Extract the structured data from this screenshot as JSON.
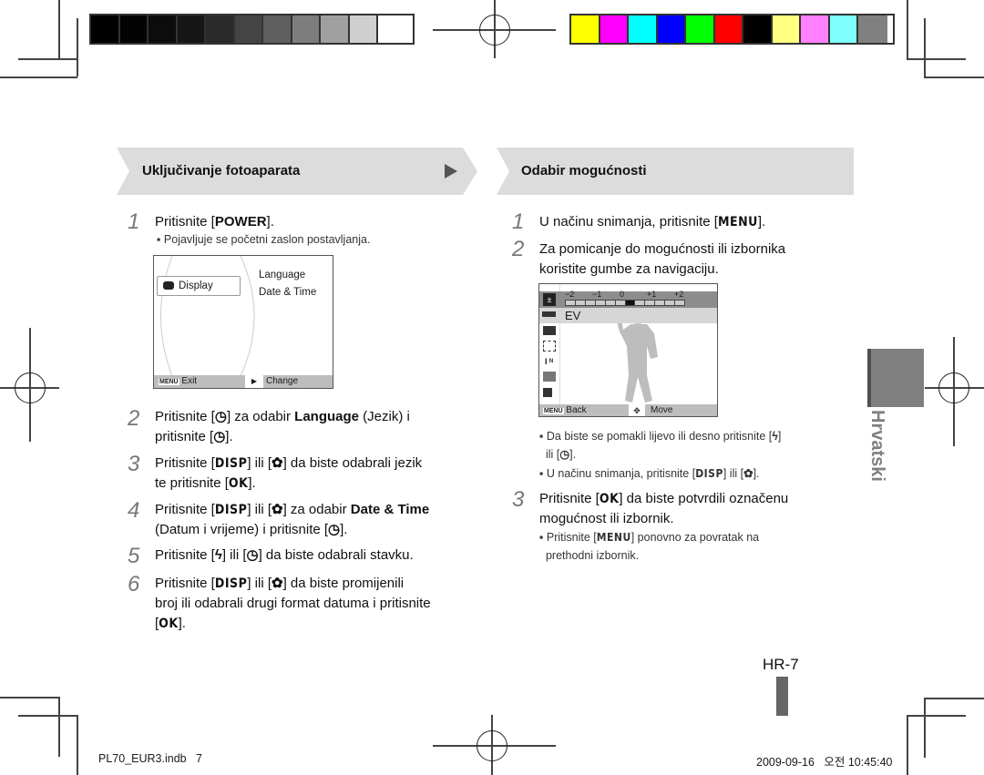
{
  "colorbars": {
    "gray": [
      "#000000",
      "#030303",
      "#0c0c0c",
      "#161616",
      "#2a2a2a",
      "#444444",
      "#5e5e5e",
      "#7d7d7d",
      "#a0a0a0",
      "#cfcfcf",
      "#ffffff"
    ],
    "color": [
      "#ffff00",
      "#ff00ff",
      "#00ffff",
      "#0000ff",
      "#00ff00",
      "#ff0000",
      "#000000",
      "#ffff80",
      "#ff80ff",
      "#80ffff",
      "#808080"
    ]
  },
  "left": {
    "header": "Uključivanje fotoaparata",
    "steps": [
      {
        "num": "1",
        "parts": [
          "Pritisnite [",
          "POWER",
          "]."
        ],
        "sub": "Pojavljuje se početni zaslon postavljanja."
      },
      {
        "num": "2",
        "line1a": "Pritisnite [",
        "icon1": "timer",
        "line1b": "] za odabir ",
        "bold": "Language",
        "line1c": " (Jezik) i",
        "line2a": "pritisnite [",
        "line2b": "]."
      },
      {
        "num": "3",
        "line1a": "Pritisnite [",
        "btn": "DISP",
        "line1b": "] ili [",
        "line1c": "] da biste odabrali jezik",
        "line2a": "te pritisnite [",
        "btn2": "OK",
        "line2b": "]."
      },
      {
        "num": "4",
        "line1a": "Pritisnite [",
        "btn": "DISP",
        "line1b": "] ili [",
        "line1c": "] za odabir ",
        "bold": "Date & Time",
        "line2a": "(Datum i vrijeme) i pritisnite [",
        "line2b": "]."
      },
      {
        "num": "5",
        "a": "Pritisnite [",
        "b": "] ili [",
        "c": "] da biste odabrali stavku."
      },
      {
        "num": "6",
        "line1a": "Pritisnite [",
        "btn": "DISP",
        "line1b": "] ili [",
        "line1c": "] da biste promijenili",
        "line2": "broj ili odabrali drugi format datuma i pritisnite",
        "line3a": "[",
        "btn2": "OK",
        "line3b": "]."
      }
    ],
    "screen": {
      "item_selected": "Display",
      "options": [
        "Language",
        "Date & Time"
      ],
      "menu_label": "MENU",
      "exit": "Exit",
      "change": "Change"
    }
  },
  "right": {
    "header": "Odabir mogućnosti",
    "step1": {
      "num": "1",
      "a": "U načinu snimanja, pritisnite [",
      "btn": "MENU",
      "b": "]."
    },
    "step2": {
      "num": "2",
      "line1": "Za pomicanje do mogućnosti ili izbornika",
      "line2": "koristite gumbe za navigaciju."
    },
    "bullets": [
      {
        "a": "Da biste se pomakli lijevo ili desno pritisnite [",
        "b": "]",
        "c": "ili [",
        "d": "]."
      },
      {
        "a": "U načinu snimanja, pritisnite [",
        "btn": "DISP",
        "b": "] ili [",
        "c": "]."
      }
    ],
    "step3": {
      "num": "3",
      "a": "Pritisnite [",
      "btn": "OK",
      "b": "] da biste potvrdili označenu",
      "line2": "mogućnost ili izbornik."
    },
    "step3_sub": {
      "a": "Pritisnite [",
      "btn": "MENU",
      "b": "] ponovno za povratak na",
      "line2": "prethodni izbornik."
    },
    "screen": {
      "ev_ticks": [
        "−2",
        "−1",
        "0",
        "+1",
        "+2"
      ],
      "ev_value": 0,
      "selected_label": "EV",
      "menu_label": "MENU",
      "back": "Back",
      "move": "Move"
    }
  },
  "side_tab": "Hrvatski",
  "page_number": "HR-7",
  "footer": {
    "file": "PL70_EUR3.indb   7",
    "timestamp": "2009-09-16   오전 10:45:40"
  }
}
